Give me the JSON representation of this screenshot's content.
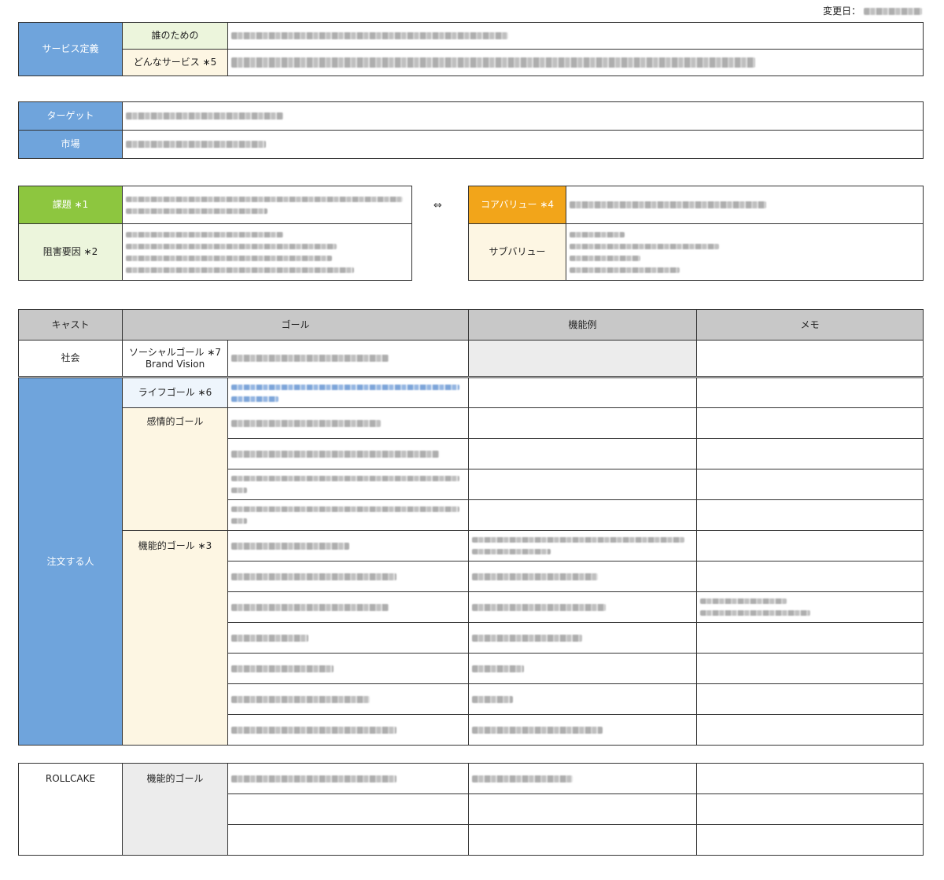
{
  "header": {
    "date_label": "変更日："
  },
  "service": {
    "title": "サービス定義",
    "for_whom_label": "誰のための",
    "what_service_label": "どんなサービス ∗5"
  },
  "target": {
    "target_label": "ターゲット",
    "market_label": "市場"
  },
  "problem": {
    "issue_label": "課題 ∗1",
    "obstacle_label": "阻害要因 ∗2",
    "arrow": "⇔",
    "core_value_label": "コアバリュー ∗4",
    "sub_value_label": "サブバリュー"
  },
  "goals": {
    "headers": {
      "cast": "キャスト",
      "goal": "ゴール",
      "feature": "機能例",
      "memo": "メモ"
    },
    "society": {
      "cast": "社会",
      "goal_type": "ソーシャルゴール ∗7",
      "goal_type_sub": "Brand Vision"
    },
    "orderer": {
      "cast": "注文する人",
      "life_goal": "ライフゴール ∗6",
      "emotional_goal": "感情的ゴール",
      "functional_goal": "機能的ゴール ∗3"
    }
  },
  "rollcake": {
    "cast": "ROLLCAKE",
    "goal_type": "機能的ゴール"
  },
  "colors": {
    "blue": "#6fa4dc",
    "green": "#8dc63f",
    "orange": "#f2a51a",
    "gray": "#c8c8c8"
  }
}
